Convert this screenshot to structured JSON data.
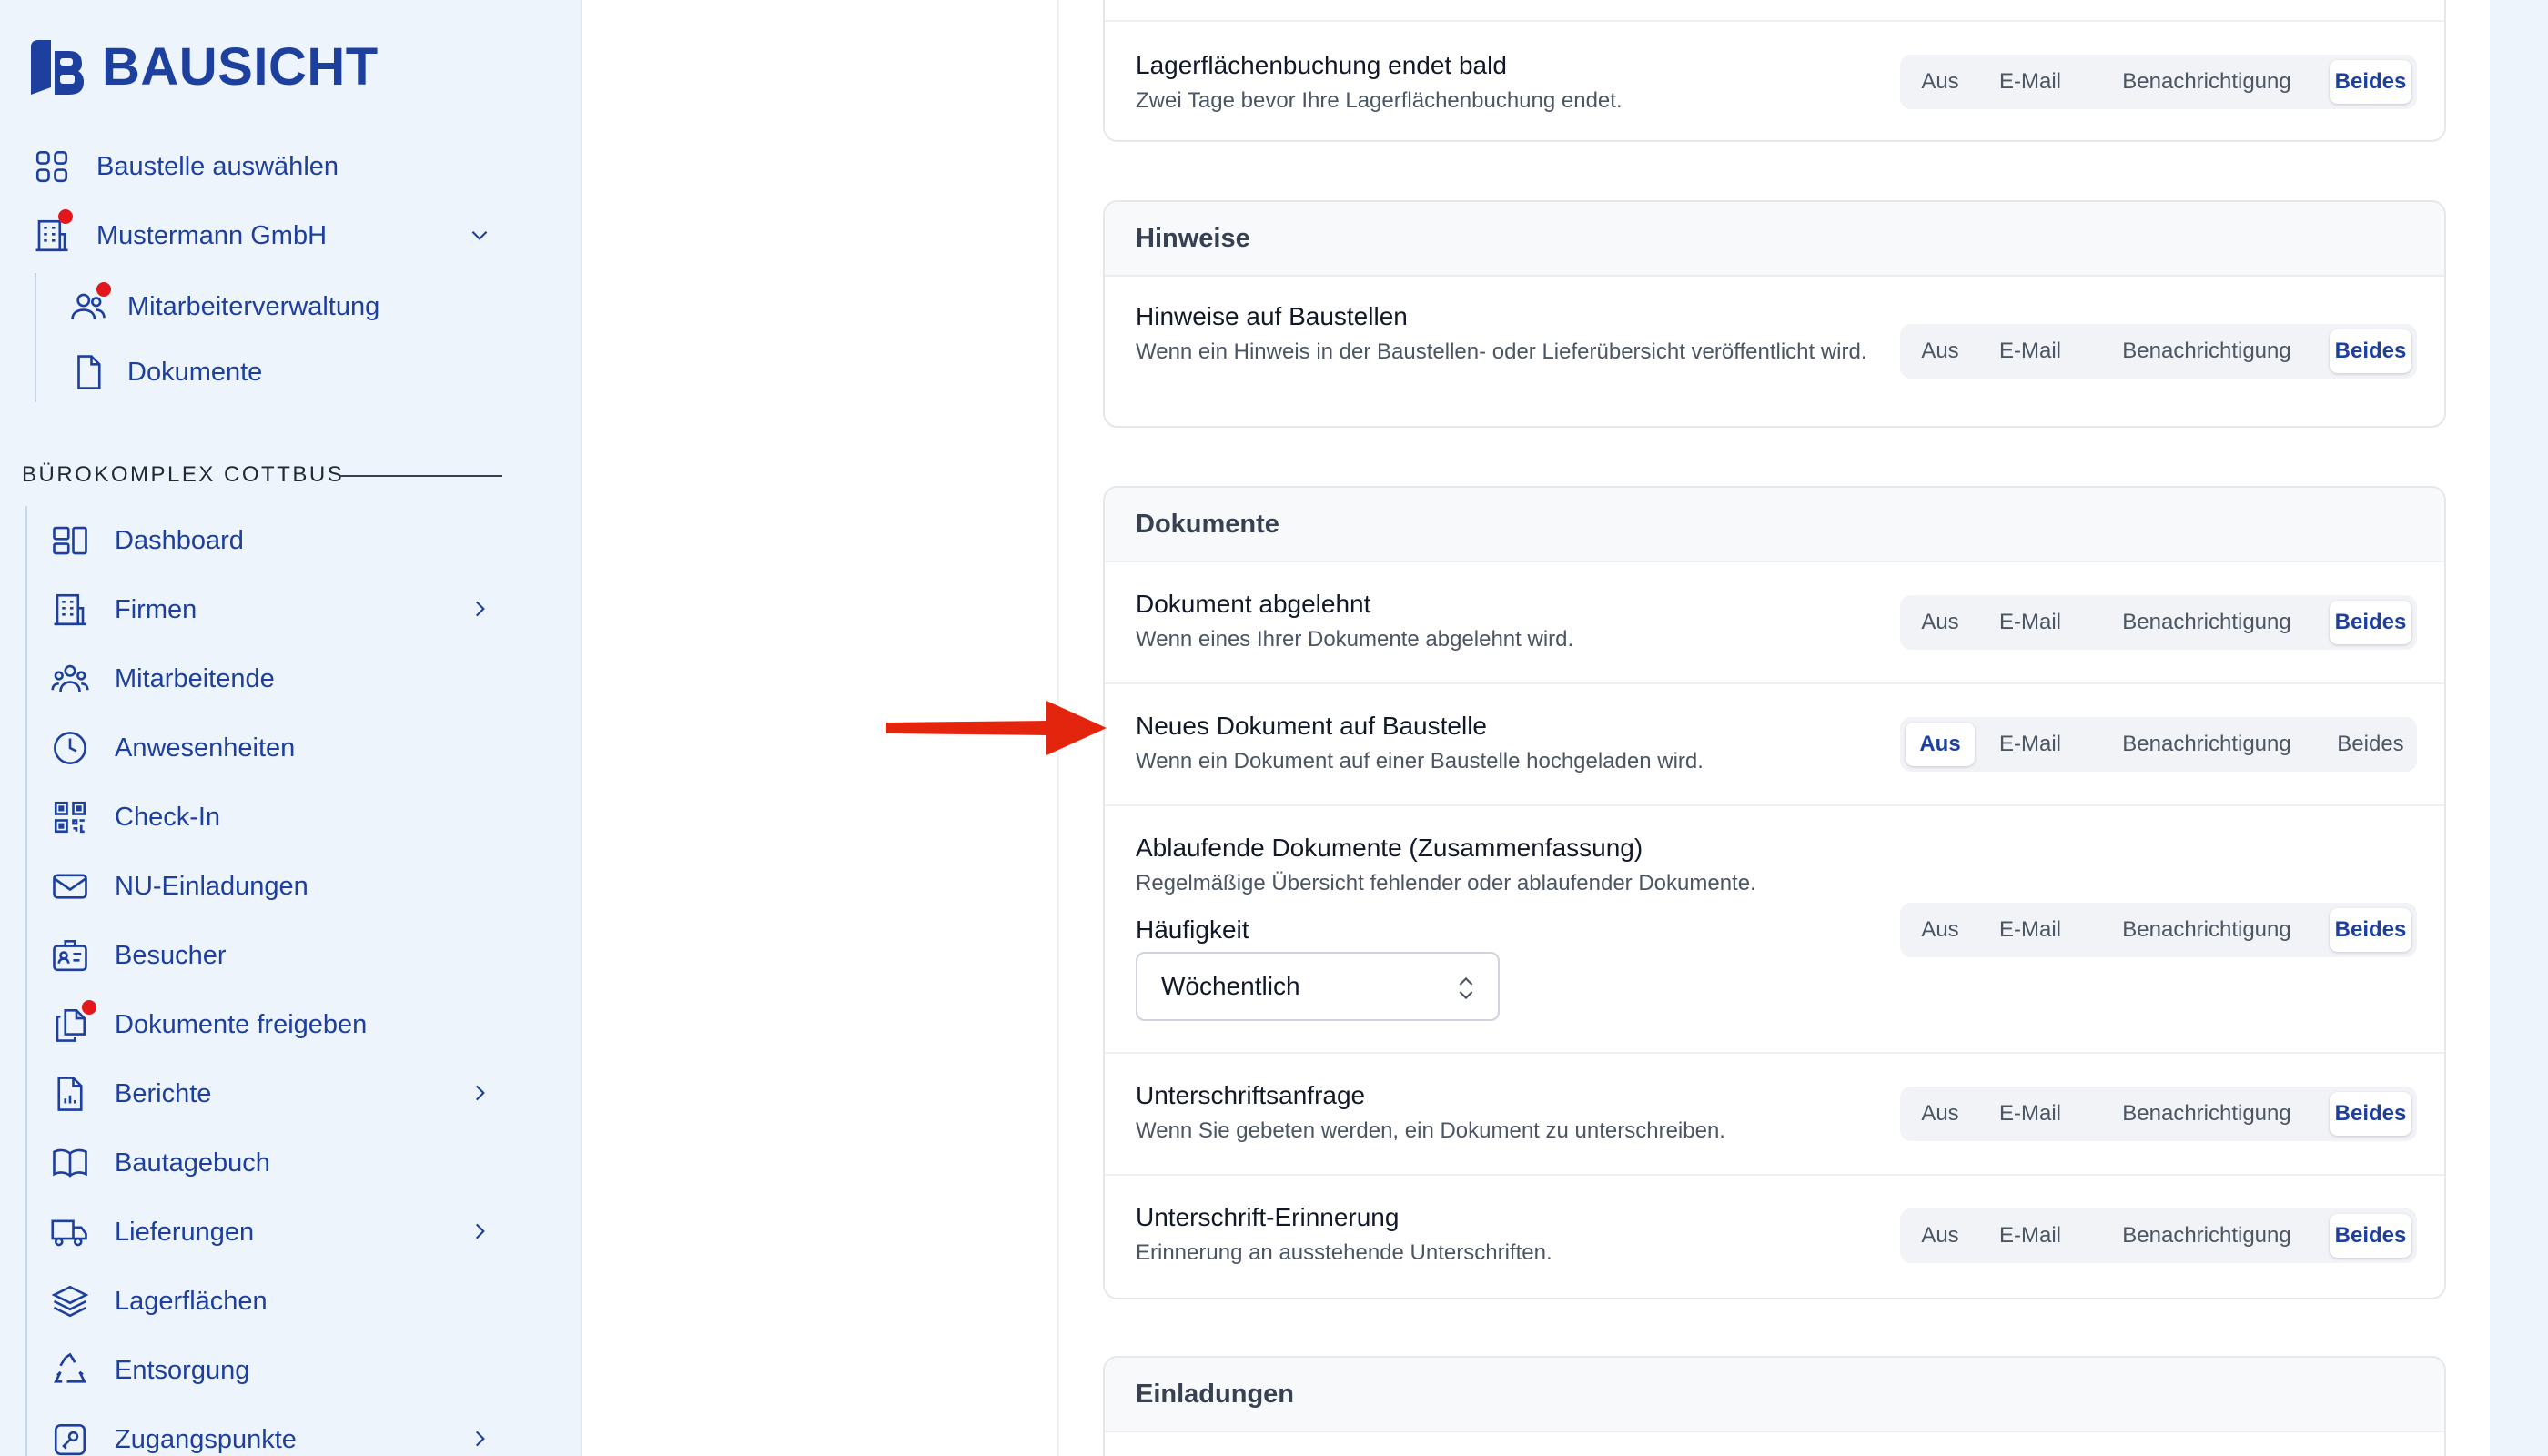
{
  "brand": {
    "name": "BAUSICHT",
    "color": "#1d3f9e"
  },
  "sidebar": {
    "top_items": [
      {
        "label": "Baustelle auswählen",
        "icon": "grid-icon"
      },
      {
        "label": "Mustermann GmbH",
        "icon": "building-icon",
        "badge": true
      },
      {
        "label": "Mitarbeiterverwaltung",
        "icon": "users-icon",
        "badge": true
      },
      {
        "label": "Dokumente",
        "icon": "document-icon"
      }
    ],
    "section_title": "BÜROKOMPLEX COTTBUS",
    "items": [
      {
        "label": "Dashboard",
        "icon": "dashboard-icon"
      },
      {
        "label": "Firmen",
        "icon": "building-icon",
        "chevron": true
      },
      {
        "label": "Mitarbeitende",
        "icon": "people-icon"
      },
      {
        "label": "Anwesenheiten",
        "icon": "clock-icon"
      },
      {
        "label": "Check-In",
        "icon": "qr-code-icon"
      },
      {
        "label": "NU-Einladungen",
        "icon": "mail-icon"
      },
      {
        "label": "Besucher",
        "icon": "badge-icon"
      },
      {
        "label": "Dokumente freigeben",
        "icon": "documents-icon",
        "badge": true
      },
      {
        "label": "Berichte",
        "icon": "report-icon",
        "chevron": true
      },
      {
        "label": "Bautagebuch",
        "icon": "book-icon"
      },
      {
        "label": "Lieferungen",
        "icon": "truck-icon",
        "chevron": true
      },
      {
        "label": "Lagerflächen",
        "icon": "layers-icon"
      },
      {
        "label": "Entsorgung",
        "icon": "recycle-icon"
      },
      {
        "label": "Zugangspunkte",
        "icon": "key-icon",
        "chevron": true
      }
    ]
  },
  "options": [
    "Aus",
    "E-Mail",
    "Benachrichtigung",
    "Beides"
  ],
  "cards": {
    "storage": {
      "rows": [
        {
          "title": "Lagerflächenbuchung endet bald",
          "desc": "Zwei Tage bevor Ihre Lagerflächenbuchung endet.",
          "selected": "Beides"
        }
      ]
    },
    "hinweise": {
      "title": "Hinweise",
      "rows": [
        {
          "title": "Hinweise auf Baustellen",
          "desc": "Wenn ein Hinweis in der Baustellen- oder Lieferübersicht veröffentlicht wird.",
          "selected": "Beides"
        }
      ]
    },
    "dokumente": {
      "title": "Dokumente",
      "rows": [
        {
          "title": "Dokument abgelehnt",
          "desc": "Wenn eines Ihrer Dokumente abgelehnt wird.",
          "selected": "Beides"
        },
        {
          "title": "Neues Dokument auf Baustelle",
          "desc": "Wenn ein Dokument auf einer Baustelle hochgeladen wird.",
          "selected": "Aus"
        },
        {
          "title": "Ablaufende Dokumente (Zusammenfassung)",
          "desc": "Regelmäßige Übersicht fehlender oder ablaufender Dokumente.",
          "selected": "Beides",
          "frequency_label": "Häufigkeit",
          "frequency_value": "Wöchentlich"
        },
        {
          "title": "Unterschriftsanfrage",
          "desc": "Wenn Sie gebeten werden, ein Dokument zu unterschreiben.",
          "selected": "Beides"
        },
        {
          "title": "Unterschrift-Erinnerung",
          "desc": "Erinnerung an ausstehende Unterschriften.",
          "selected": "Beides"
        }
      ]
    },
    "einladungen": {
      "title": "Einladungen"
    }
  },
  "annotation": {
    "arrow_color": "#e4250e",
    "badge_color": "#e3161c"
  }
}
